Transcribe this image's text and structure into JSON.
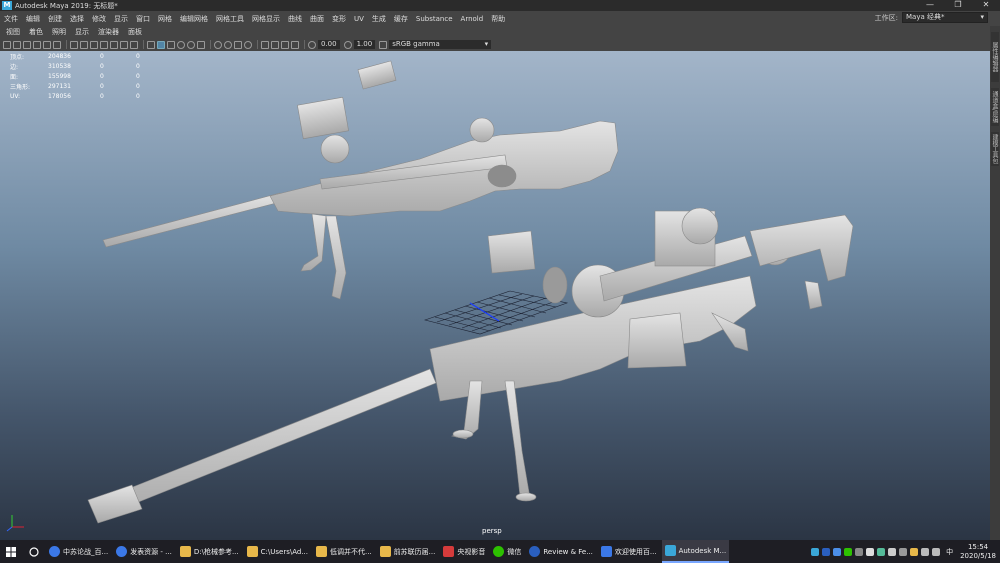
{
  "window": {
    "title": "Autodesk Maya 2019: 无标题*",
    "app_icon": "M",
    "controls": [
      "—",
      "❐",
      "✕"
    ]
  },
  "menubar": {
    "items": [
      "文件",
      "编辑",
      "创建",
      "选择",
      "修改",
      "显示",
      "窗口",
      "网格",
      "编辑网格",
      "网格工具",
      "网格显示",
      "曲线",
      "曲面",
      "变形",
      "UV",
      "生成",
      "缓存",
      "Substance",
      "Arnold",
      "帮助"
    ],
    "workspace_label": "工作区:",
    "workspace_value": "Maya 经典*"
  },
  "panel_menu": {
    "items": [
      "视图",
      "着色",
      "照明",
      "显示",
      "渲染器",
      "面板"
    ]
  },
  "toolbar": {
    "exposure": "0.00",
    "gamma": "1.00",
    "color_space": "sRGB gamma"
  },
  "side_tabs": [
    "属性编辑器",
    "通道盒/层编辑器",
    "建模工具包"
  ],
  "hud": {
    "rows": [
      {
        "label": "顶点:",
        "value": "204836",
        "sel": "0",
        "comp": "0"
      },
      {
        "label": "边:",
        "value": "310538",
        "sel": "0",
        "comp": "0"
      },
      {
        "label": "面:",
        "value": "155998",
        "sel": "0",
        "comp": "0"
      },
      {
        "label": "三角形:",
        "value": "297131",
        "sel": "0",
        "comp": "0"
      },
      {
        "label": "UV:",
        "value": "178056",
        "sel": "0",
        "comp": "0"
      }
    ]
  },
  "viewport": {
    "camera": "persp"
  },
  "taskbar": {
    "tasks": [
      {
        "label": "中苏论战_百...",
        "color": "#3b78e7"
      },
      {
        "label": "发表资源 - ...",
        "color": "#3b78e7"
      },
      {
        "label": "D:\\枪械参考...",
        "color": "#e8b84a"
      },
      {
        "label": "C:\\Users\\Ad...",
        "color": "#e8b84a"
      },
      {
        "label": "低调并不代...",
        "color": "#e8b84a"
      },
      {
        "label": "前苏联历届...",
        "color": "#e8b84a"
      },
      {
        "label": "央视影音",
        "color": "#d63b3b"
      },
      {
        "label": "微信",
        "color": "#2dc100"
      },
      {
        "label": "Review & Fe...",
        "color": "#2a5fbf"
      },
      {
        "label": "欢迎使用百...",
        "color": "#3b78e7"
      },
      {
        "label": "Autodesk M...",
        "color": "#3aa7d8",
        "active": true
      }
    ],
    "tray_input": "中",
    "time": "15:54",
    "date": "2020/5/18"
  }
}
